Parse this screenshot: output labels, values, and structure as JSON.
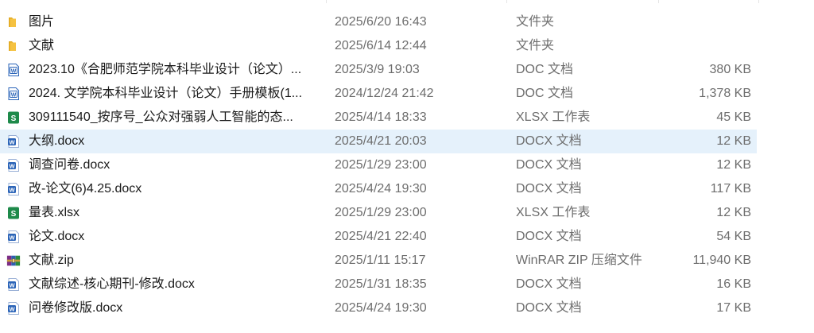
{
  "files": [
    {
      "name": "图片",
      "date": "2025/6/20 16:43",
      "type": "文件夹",
      "size": "",
      "icon": "folder-icon"
    },
    {
      "name": "文献",
      "date": "2025/6/14 12:44",
      "type": "文件夹",
      "size": "",
      "icon": "folder-icon"
    },
    {
      "name": "2023.10《合肥师范学院本科毕业设计（论文）...",
      "date": "2025/3/9 19:03",
      "type": "DOC 文档",
      "size": "380 KB",
      "icon": "word-doc-icon"
    },
    {
      "name": "2024. 文学院本科毕业设计（论文）手册模板(1...",
      "date": "2024/12/24 21:42",
      "type": "DOC 文档",
      "size": "1,378 KB",
      "icon": "word-doc-icon"
    },
    {
      "name": "309111540_按序号_公众对强弱人工智能的态...",
      "date": "2025/4/14 18:33",
      "type": "XLSX 工作表",
      "size": "45 KB",
      "icon": "spreadsheet-icon"
    },
    {
      "name": "大纲.docx",
      "date": "2025/4/21 20:03",
      "type": "DOCX 文档",
      "size": "12 KB",
      "icon": "word-docx-icon"
    },
    {
      "name": "调查问卷.docx",
      "date": "2025/1/29 23:00",
      "type": "DOCX 文档",
      "size": "12 KB",
      "icon": "word-docx-icon"
    },
    {
      "name": "改-论文(6)4.25.docx",
      "date": "2025/4/24 19:30",
      "type": "DOCX 文档",
      "size": "117 KB",
      "icon": "word-docx-icon"
    },
    {
      "name": "量表.xlsx",
      "date": "2025/1/29 23:00",
      "type": "XLSX 工作表",
      "size": "12 KB",
      "icon": "spreadsheet-icon"
    },
    {
      "name": "论文.docx",
      "date": "2025/4/21 22:40",
      "type": "DOCX 文档",
      "size": "54 KB",
      "icon": "word-docx-icon"
    },
    {
      "name": "文献.zip",
      "date": "2025/1/11 15:17",
      "type": "WinRAR ZIP 压缩文件",
      "size": "11,940 KB",
      "icon": "winrar-archive-icon"
    },
    {
      "name": "文献综述-核心期刊-修改.docx",
      "date": "2025/1/31 18:35",
      "type": "DOCX 文档",
      "size": "16 KB",
      "icon": "word-docx-icon"
    },
    {
      "name": "问卷修改版.docx",
      "date": "2025/4/24 19:30",
      "type": "DOCX 文档",
      "size": "17 KB",
      "icon": "word-docx-icon"
    }
  ],
  "selected_index": 5,
  "colors": {
    "folder": "#f5c242",
    "word": "#2b64b8",
    "excel": "#1e8a4a",
    "selection": "#e5f1fb"
  }
}
